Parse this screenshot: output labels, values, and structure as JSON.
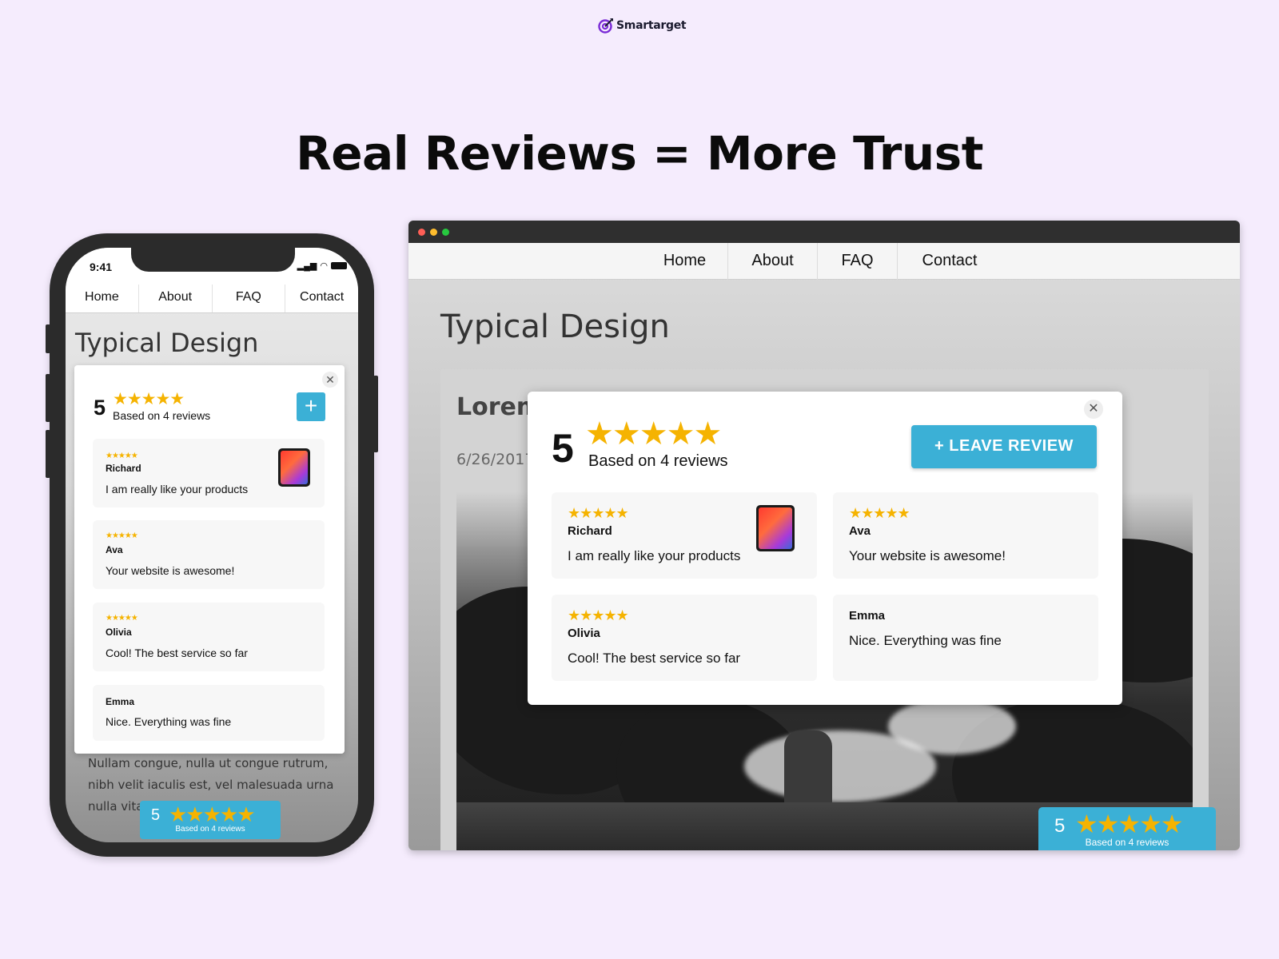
{
  "brand": {
    "name": "Smartarget",
    "accent": "#7a2bd6"
  },
  "headline": "Real Reviews = More Trust",
  "star_glyph": "★★★★★",
  "phone": {
    "status_time": "9:41",
    "nav": [
      "Home",
      "About",
      "FAQ",
      "Contact"
    ],
    "page_title": "Typical Design",
    "body_text": "Nullam congue, nulla ut congue rutrum, nibh velit iaculis est, vel malesuada urna nulla vita",
    "modal": {
      "score": "5",
      "based_on": "Based on 4 reviews",
      "add_label": "+",
      "close_label": "✕",
      "reviews": [
        {
          "name": "Richard",
          "text": "I am really like your products",
          "rating": 5,
          "has_image": true
        },
        {
          "name": "Ava",
          "text": "Your website is awesome!",
          "rating": 5
        },
        {
          "name": "Olivia",
          "text": "Cool! The best service so far",
          "rating": 5
        },
        {
          "name": "Emma",
          "text": "Nice. Everything was fine",
          "rating": 0
        }
      ]
    },
    "widget": {
      "score": "5",
      "based_on": "Based on 4 reviews"
    }
  },
  "browser": {
    "nav": [
      "Home",
      "About",
      "FAQ",
      "Contact"
    ],
    "page_title": "Typical Design",
    "post_title": "Lorem",
    "post_date": "6/26/2017",
    "modal": {
      "score": "5",
      "based_on": "Based on 4 reviews",
      "leave_review_label": "+  LEAVE REVIEW",
      "close_label": "✕",
      "reviews": [
        {
          "name": "Richard",
          "text": "I am really like your products",
          "rating": 5,
          "has_image": true
        },
        {
          "name": "Ava",
          "text": "Your website is awesome!",
          "rating": 5
        },
        {
          "name": "Olivia",
          "text": "Cool! The best service so far",
          "rating": 5
        },
        {
          "name": "Emma",
          "text": "Nice. Everything was fine",
          "rating": 0
        }
      ]
    },
    "widget": {
      "score": "5",
      "based_on": "Based on 4 reviews"
    }
  },
  "colors": {
    "background": "#f5ecfd",
    "button": "#3bb0d6",
    "star": "#f5b301"
  }
}
